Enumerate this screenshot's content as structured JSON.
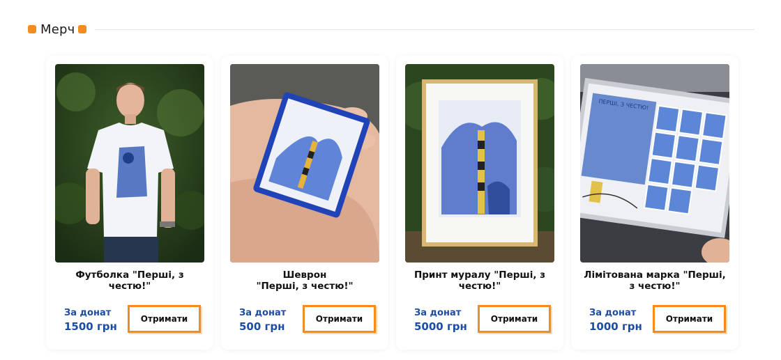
{
  "section": {
    "title": "Мерч"
  },
  "colors": {
    "accent": "#f28c1e",
    "price": "#1c4da3"
  },
  "products": [
    {
      "title": "Футболка \"Перші, з\nчестю!\"",
      "price_label": "За донат",
      "price": "1500 грн",
      "button": "Отримати",
      "image": "t-shirt-photo"
    },
    {
      "title": "Шеврон\n\"Перші, з честю!\"",
      "price_label": "За донат",
      "price": "500 грн",
      "button": "Отримати",
      "image": "chevron-patch-photo"
    },
    {
      "title": "Принт муралу \"Перші, з\nчестю!\"",
      "price_label": "За донат",
      "price": "5000 грн",
      "button": "Отримати",
      "image": "framed-print-photo"
    },
    {
      "title": "Лімітована марка \"Перші,\nз честю!\"",
      "price_label": "За донат",
      "price": "1000 грн",
      "button": "Отримати",
      "image": "stamp-sheet-photo",
      "photo_text": "ПЕРШІ, З ЧЕСТЮ!"
    }
  ]
}
